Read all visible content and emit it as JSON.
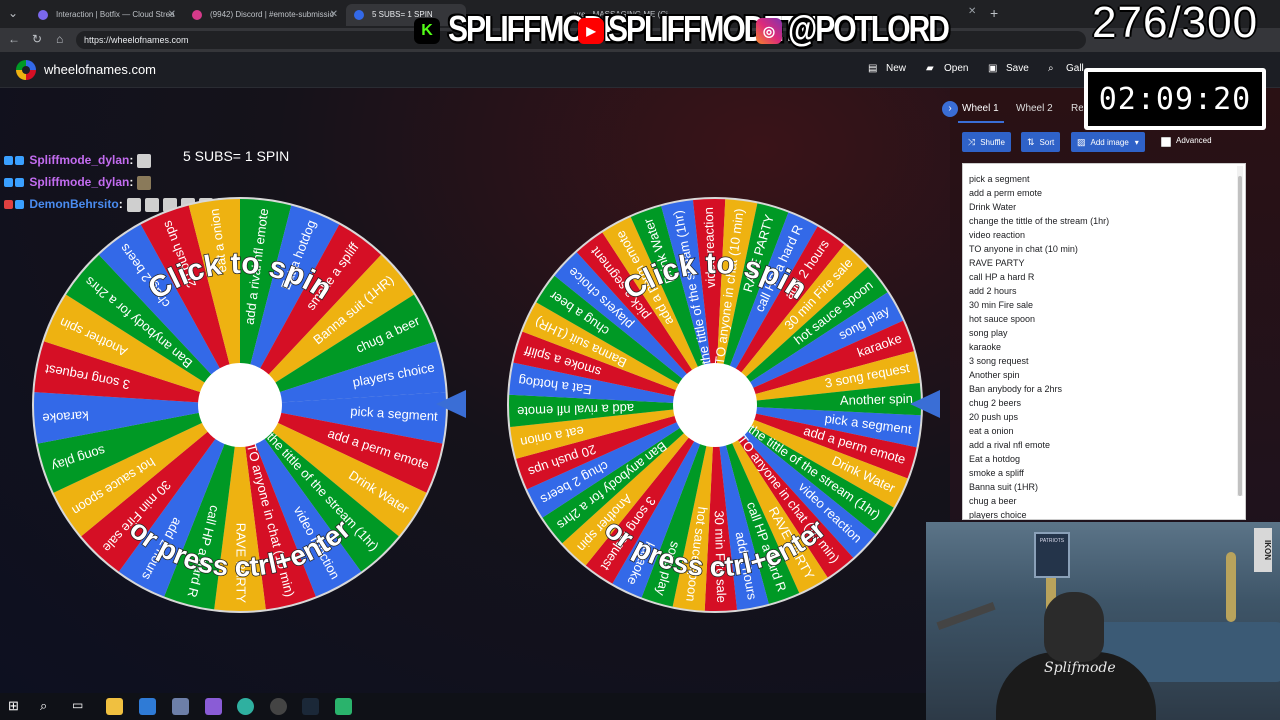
{
  "browser": {
    "tabs": [
      {
        "label": "Interaction | Botfix — Cloud Strea",
        "fav": "#7b68ee",
        "active": false
      },
      {
        "label": "(9942) Discord | #emote-submissio",
        "fav": "#5865f2",
        "active": false
      },
      {
        "label": "5 SUBS= 1 SPIN",
        "fav": "#3369e8",
        "active": true
      },
      {
        "label": "ure - MASSAGING ME (Ci",
        "fav": "#888",
        "active": false
      }
    ],
    "url": "https://wheelofnames.com"
  },
  "stream_overlay": {
    "kick_handle": "SPLIFFMODE",
    "youtube_handle": "SPLIFFMODETV",
    "instagram_handle": "@POTLORD",
    "sub_counter": "276/300",
    "timer": "02:09:20"
  },
  "site": {
    "title": "wheelofnames.com",
    "header_buttons": [
      {
        "label": "New",
        "icon": "file-icon"
      },
      {
        "label": "Open",
        "icon": "folder-icon"
      },
      {
        "label": "Save",
        "icon": "save-icon"
      },
      {
        "label": "Gall",
        "icon": "search-icon"
      }
    ]
  },
  "chat": {
    "rule": "5 SUBS= 1 SPIN",
    "lines": [
      {
        "user": "Spliffmode_dylan",
        "color": "#c36cf0"
      },
      {
        "user": "Spliffmode_dylan",
        "color": "#c36cf0"
      },
      {
        "user": "DemonBehrsito",
        "color": "#4a8cf0"
      }
    ]
  },
  "wheels": {
    "overlay_top": "Click to spin",
    "overlay_bottom": "or press ctrl+enter",
    "colors": [
      "#3369e8",
      "#d50f25",
      "#eeb211",
      "#009925"
    ]
  },
  "panel": {
    "tabs": [
      "Wheel 1",
      "Wheel 2",
      "Results"
    ],
    "buttons": [
      {
        "label": "Shuffle",
        "icon": "shuffle-icon"
      },
      {
        "label": "Sort",
        "icon": "sort-icon"
      },
      {
        "label": "Add image",
        "icon": "image-icon"
      }
    ],
    "advanced_label": "Advanced",
    "entries": [
      "pick a segment",
      "add a perm emote",
      "Drink Water",
      "change the tittle of the stream (1hr)",
      "video reaction",
      "TO anyone in chat (10 min)",
      "RAVE PARTY",
      "call HP a hard R",
      "add 2 hours",
      "30 min Fire sale",
      "hot sauce spoon",
      "song play",
      "karaoke",
      "3 song request",
      "Another spin",
      "Ban anybody for a 2hrs",
      "chug 2 beers",
      "20 push ups",
      "eat a onion",
      "add a rival nfl emote",
      "Eat a hotdog",
      "smoke a spliff",
      "Banna suit (1HR)",
      "chug a beer",
      "players choice"
    ]
  },
  "webcam": {
    "shirt_text": "Splifmode",
    "banner_text": "IKON",
    "poster_text": "PATRIOTS"
  }
}
